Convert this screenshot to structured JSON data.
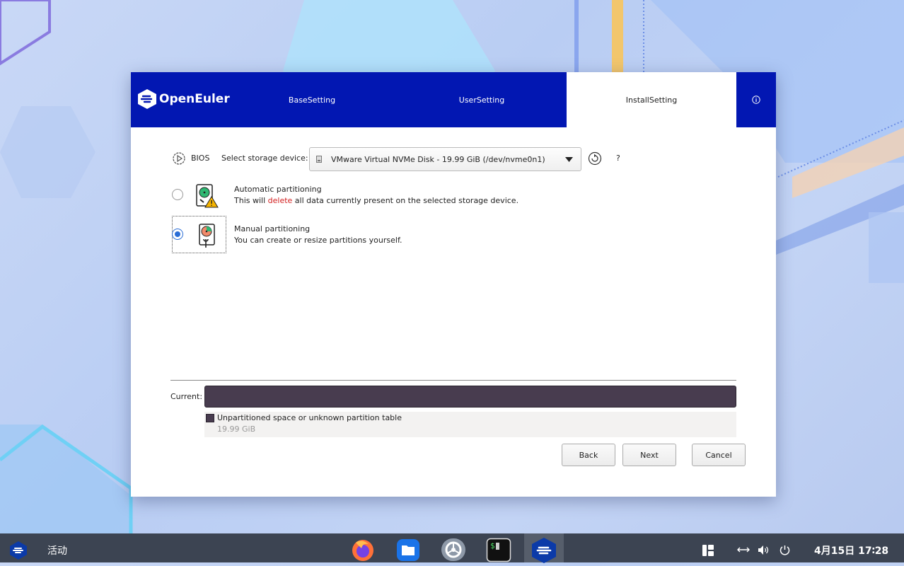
{
  "app": {
    "brand": "OpenEuler",
    "tabs": [
      {
        "label": "BaseSetting"
      },
      {
        "label": "UserSetting"
      },
      {
        "label": "InstallSetting"
      }
    ],
    "info_icon": "info-icon"
  },
  "storage": {
    "boot_mode": "BIOS",
    "select_label": "Select storage device:",
    "device": "VMware Virtual NVMe Disk - 19.99 GiB (/dev/nvme0n1)",
    "help": "?"
  },
  "options": [
    {
      "title": "Automatic partitioning",
      "desc_pre": "This will ",
      "desc_warn": "delete",
      "desc_post": " all data currently present on the selected storage device.",
      "selected": false
    },
    {
      "title": "Manual partitioning",
      "desc": "You can create or resize partitions yourself.",
      "selected": true
    }
  ],
  "current": {
    "label": "Current:",
    "legend_label": "Unpartitioned space or unknown partition table",
    "legend_size": "19.99 GiB",
    "bar_color": "#483c4f"
  },
  "buttons": {
    "back": "Back",
    "next": "Next",
    "cancel": "Cancel"
  },
  "taskbar": {
    "activities": "活动",
    "clock": "4月15日 17∶28"
  },
  "colors": {
    "header": "#0217b2",
    "warning_text": "#d21e1e",
    "accent": "#2a6dd6"
  }
}
